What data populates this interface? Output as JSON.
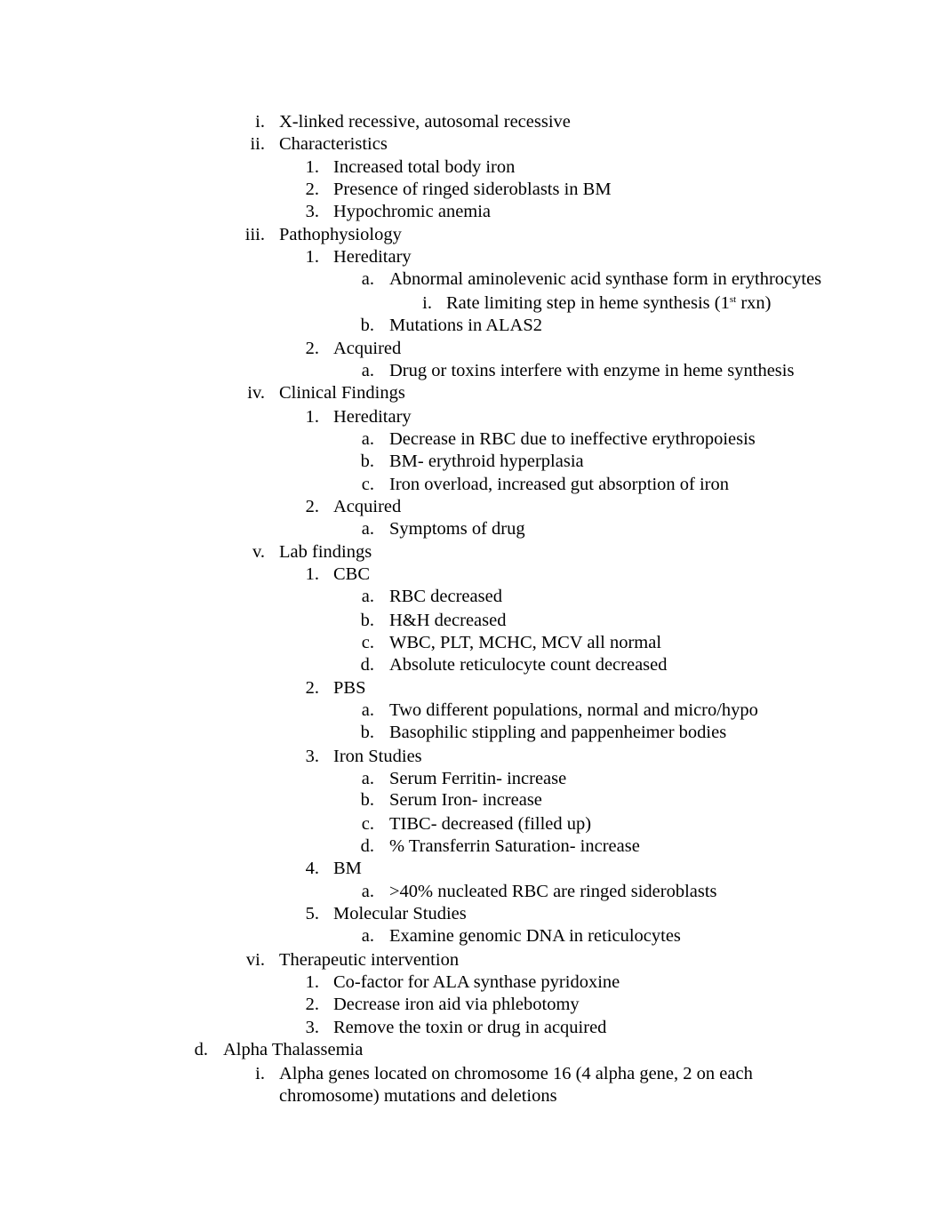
{
  "document": {
    "lines": [
      {
        "level": 1,
        "marker": "i.",
        "text": "X-linked recessive, autosomal recessive"
      },
      {
        "level": 1,
        "marker": "ii.",
        "text": "Characteristics"
      },
      {
        "level": 2,
        "marker": "1.",
        "text": "Increased total body iron"
      },
      {
        "level": 2,
        "marker": "2.",
        "text": "Presence of ringed sideroblasts in BM"
      },
      {
        "level": 2,
        "marker": "3.",
        "text": "Hypochromic anemia"
      },
      {
        "level": 1,
        "marker": "iii.",
        "text": "Pathophysiology"
      },
      {
        "level": 2,
        "marker": "1.",
        "text": "Hereditary"
      },
      {
        "level": 3,
        "marker": "a.",
        "text": "Abnormal aminolevenic acid synthase form in erythrocytes"
      },
      {
        "level": 4,
        "marker": "i.",
        "text": "Rate limiting step in heme synthesis (1",
        "sup": "st",
        "text_after": " rxn)"
      },
      {
        "level": 3,
        "marker": "b.",
        "text": "Mutations in ALAS2"
      },
      {
        "level": 2,
        "marker": "2.",
        "text": "Acquired"
      },
      {
        "level": 3,
        "marker": "a.",
        "text": "Drug or toxins interfere with enzyme in heme synthesis"
      },
      {
        "level": 1,
        "marker": "iv.",
        "text": "Clinical Findings"
      },
      {
        "level": 2,
        "marker": "1.",
        "text": "Hereditary"
      },
      {
        "level": 3,
        "marker": "a.",
        "text": "Decrease in RBC due to ineffective erythropoiesis"
      },
      {
        "level": 3,
        "marker": "b.",
        "text": "BM- erythroid hyperplasia"
      },
      {
        "level": 3,
        "marker": "c.",
        "text": "Iron overload, increased gut absorption of iron"
      },
      {
        "level": 2,
        "marker": "2.",
        "text": "Acquired"
      },
      {
        "level": 3,
        "marker": "a.",
        "text": "Symptoms of drug"
      },
      {
        "level": 1,
        "marker": "v.",
        "text": "Lab findings"
      },
      {
        "level": 2,
        "marker": "1.",
        "text": "CBC"
      },
      {
        "level": 3,
        "marker": "a.",
        "text": "RBC decreased"
      },
      {
        "level": 3,
        "marker": "b.",
        "text": "H&H decreased"
      },
      {
        "level": 3,
        "marker": "c.",
        "text": "WBC, PLT, MCHC, MCV all normal"
      },
      {
        "level": 3,
        "marker": "d.",
        "text": "Absolute reticulocyte count decreased"
      },
      {
        "level": 2,
        "marker": "2.",
        "text": "PBS"
      },
      {
        "level": 3,
        "marker": "a.",
        "text": "Two different populations, normal and micro/hypo"
      },
      {
        "level": 3,
        "marker": "b.",
        "text": "Basophilic stippling and pappenheimer bodies"
      },
      {
        "level": 2,
        "marker": "3.",
        "text": "Iron Studies"
      },
      {
        "level": 3,
        "marker": "a.",
        "text": "Serum Ferritin- increase"
      },
      {
        "level": 3,
        "marker": "b.",
        "text": "Serum Iron- increase"
      },
      {
        "level": 3,
        "marker": "c.",
        "text": "TIBC- decreased (filled up)"
      },
      {
        "level": 3,
        "marker": "d.",
        "text": "% Transferrin Saturation- increase"
      },
      {
        "level": 2,
        "marker": "4.",
        "text": "BM"
      },
      {
        "level": 3,
        "marker": "a.",
        "text": ">40% nucleated RBC are ringed sideroblasts"
      },
      {
        "level": 2,
        "marker": "5.",
        "text": "Molecular Studies"
      },
      {
        "level": 3,
        "marker": "a.",
        "text": "Examine genomic DNA in reticulocytes"
      },
      {
        "level": 1,
        "marker": "vi.",
        "text": "Therapeutic intervention"
      },
      {
        "level": 2,
        "marker": "1.",
        "text": "Co-factor for ALA synthase pyridoxine"
      },
      {
        "level": 2,
        "marker": "2.",
        "text": "Decrease iron aid via phlebotomy"
      },
      {
        "level": 2,
        "marker": "3.",
        "text": "Remove the toxin or drug in acquired"
      },
      {
        "level": 0,
        "marker": "d.",
        "text": "Alpha Thalassemia"
      },
      {
        "level": 1,
        "marker": "i.",
        "text": "Alpha genes located on chromosome 16 (4 alpha gene, 2 on each"
      },
      {
        "level": 1,
        "marker": "",
        "text": "chromosome) mutations and deletions"
      }
    ]
  }
}
